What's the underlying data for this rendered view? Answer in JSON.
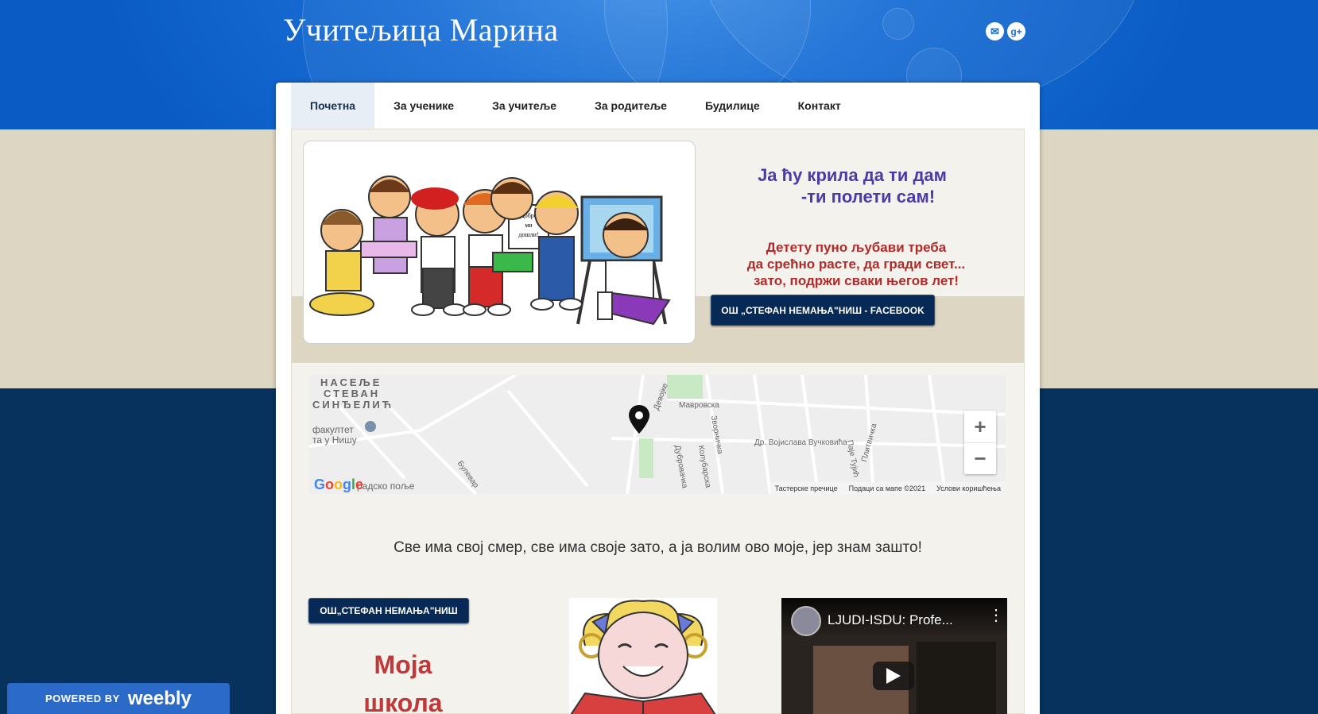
{
  "site": {
    "title": "Учитељица Марина"
  },
  "social": {
    "email_icon": "envelope-icon",
    "gplus_icon": "google-plus-icon",
    "gplus_glyph": "g+",
    "email_glyph": "✉"
  },
  "nav": {
    "items": [
      {
        "label": "Почетна",
        "active": true
      },
      {
        "label": "За ученике"
      },
      {
        "label": "За учитеље"
      },
      {
        "label": "За родитеље"
      },
      {
        "label": "Будилице"
      },
      {
        "label": "Контакт"
      }
    ]
  },
  "hero": {
    "image_sign_text": "Добро ми дошли!",
    "slogan_line1": "Ја ћу крила да ти дам",
    "slogan_line2": "-ти полети сам!",
    "message_line1": "Детету пуно љубави треба",
    "message_line2": "да срећно расте, да гради свет...",
    "message_line3": "зато, подржи сваки његов лет!",
    "facebook_button": "ОШ „СТЕФАН НЕМАЊА\"НИШ - FACEBOOK"
  },
  "map": {
    "labels": {
      "area1": "НАСЕЉЕ",
      "area2": "СТЕВАН",
      "area3": "СИНЂЕЛИЋ",
      "faculty1": "факултет",
      "faculty2": "та у Нишу",
      "street_mavrovska": "Мавровска",
      "street_vojislava": "Др. Војислава Вучковића",
      "street_bulevar": "Булевар",
      "street_grad": "радско поље",
      "street_devojke": "Девојке",
      "street_zvornicka": "Зворничка",
      "street_kolubarska": "Колубарска",
      "street_dubrovacka": "Дубровачка",
      "street_plitvicka": "Плитвичка",
      "street_pave": "Паје Тујић"
    },
    "zoom_in": "+",
    "zoom_out": "−",
    "footer": {
      "shortcuts": "Тастерске пречице",
      "data": "Подаци са мапе ©2021",
      "terms": "Услови коришћења"
    },
    "logo": "Google"
  },
  "motto": "Све има свој смер, све има своје зато, а ја волим ово моје, јер знам зашто!",
  "school": {
    "button": "ОШ„СТЕФАН НЕМАЊА\"НИШ",
    "title_line1": "Моја",
    "title_line2": "школа"
  },
  "video": {
    "title": "LJUDI-ISDU: Profe...",
    "menu_glyph": "⋮"
  },
  "weebly": {
    "powered": "POWERED BY",
    "brand": "weebly"
  }
}
